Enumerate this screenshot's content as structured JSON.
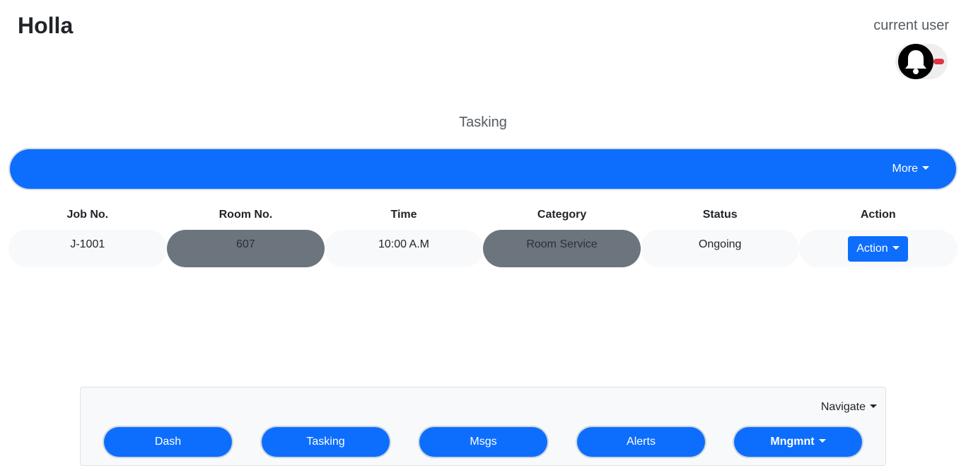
{
  "header": {
    "title": "Holla",
    "user_label": "current user",
    "bell_icon": "bell-icon",
    "badge_color": "#dc3545"
  },
  "page": {
    "section_title": "Tasking"
  },
  "topbar": {
    "more_label": "More",
    "color": "#0d6efd"
  },
  "table": {
    "headers": [
      "Job No.",
      "Room No.",
      "Time",
      "Category",
      "Status",
      "Action"
    ],
    "rows": [
      {
        "job_no": "J-1001",
        "room_no": "607",
        "time": "10:00 A.M",
        "category": "Room Service",
        "status": "Ongoing",
        "action_label": "Action"
      }
    ]
  },
  "nav": {
    "navigate_label": "Navigate",
    "buttons": [
      "Dash",
      "Tasking",
      "Msgs",
      "Alerts",
      "Mngmnt"
    ]
  }
}
